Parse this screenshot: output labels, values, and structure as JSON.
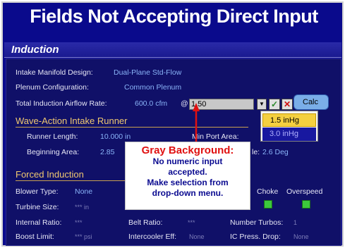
{
  "page_title": "Fields Not Accepting Direct Input",
  "section_title": "Induction",
  "fields": {
    "intake_manifold": {
      "label": "Intake Manifold Design:",
      "value": "Dual-Plane Std-Flow"
    },
    "plenum": {
      "label": "Plenum Configuration:",
      "value": "Common Plenum"
    },
    "airflow": {
      "label": "Total Induction Airflow Rate:",
      "value": "600.0 cfm",
      "at": "@",
      "input_value": "1.50"
    }
  },
  "buttons": {
    "dropdown_icon": "▼",
    "ok_icon": "✓",
    "cancel_icon": "✕",
    "calc_label": "Calc"
  },
  "dropdown_options": [
    "1.5 inHg",
    "3.0 inHg"
  ],
  "wave_action": {
    "title": "Wave-Action Intake Runner",
    "runner_length": {
      "label": "Runner Length:",
      "value": "10.000 in"
    },
    "min_port": {
      "label": "Min Port Area:"
    },
    "beginning_area": {
      "label": "Beginning Area:",
      "value": "2.85"
    },
    "taper_fragment": {
      "label": "le:",
      "value": "2.6 Deg"
    }
  },
  "forced": {
    "title": "Forced Induction",
    "blower_type": {
      "label": "Blower Type:",
      "value": "None"
    },
    "turbine_size": {
      "label": "Turbine Size:",
      "value": "*** in"
    },
    "internal_ratio": {
      "label": "Internal Ratio:",
      "value": "***"
    },
    "boost_limit": {
      "label": "Boost Limit:",
      "value": "*** psi"
    },
    "belt_ratio": {
      "label": "Belt Ratio:",
      "value": "***"
    },
    "intercooler": {
      "label": "Intercooler Eff:",
      "value": "None"
    },
    "num_turbos": {
      "label": "Number Turbos:",
      "value": "1"
    },
    "ic_drop": {
      "label": "IC Press. Drop:",
      "value": "None"
    },
    "choke": {
      "label": "Choke"
    },
    "overspeed": {
      "label": "Overspeed"
    }
  },
  "callout": {
    "heading": "Gray Background:",
    "lines": [
      "No numeric input",
      "accepted.",
      "Make selection from",
      "drop-down menu."
    ]
  },
  "colors": {
    "background": "#0a0a8c",
    "accent": "#f0c870",
    "value": "#8ab4f8",
    "callout_heading": "#e01010"
  }
}
